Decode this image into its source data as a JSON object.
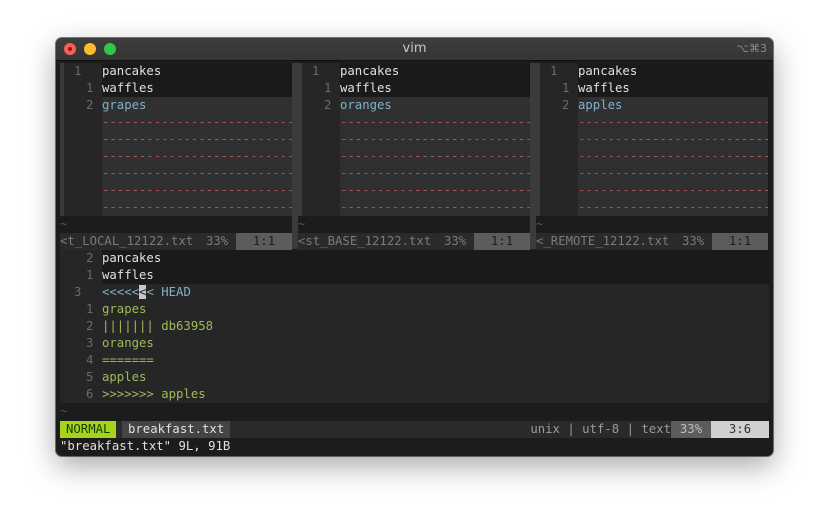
{
  "window": {
    "title": "vim",
    "shortcut": "⌥⌘3"
  },
  "panes": [
    {
      "name": "local",
      "lines": [
        {
          "num": "1",
          "text": "pancakes",
          "style": "dark",
          "numpos": "far"
        },
        {
          "num": "1",
          "text": "waffles",
          "style": "dark",
          "numpos": "near"
        },
        {
          "num": "2",
          "text": "grapes",
          "style": "blue",
          "numpos": "near"
        }
      ],
      "filler_count": 6,
      "filler": "------------------------------------------------------",
      "tilde": "~",
      "status": {
        "filename": "<t_LOCAL_12122.txt",
        "percent": "33%",
        "position": "1:1"
      }
    },
    {
      "name": "base",
      "lines": [
        {
          "num": "1",
          "text": "pancakes",
          "style": "dark",
          "numpos": "far"
        },
        {
          "num": "1",
          "text": "waffles",
          "style": "dark",
          "numpos": "near"
        },
        {
          "num": "2",
          "text": "oranges",
          "style": "blue",
          "numpos": "near"
        }
      ],
      "filler_count": 6,
      "filler": "------------------------------------------------------",
      "tilde": "~",
      "status": {
        "filename": "<st_BASE_12122.txt",
        "percent": "33%",
        "position": "1:1"
      }
    },
    {
      "name": "remote",
      "lines": [
        {
          "num": "1",
          "text": "pancakes",
          "style": "dark",
          "numpos": "far"
        },
        {
          "num": "1",
          "text": "waffles",
          "style": "dark",
          "numpos": "near"
        },
        {
          "num": "2",
          "text": "apples",
          "style": "blue",
          "numpos": "near"
        }
      ],
      "filler_count": 6,
      "filler": "------------------------------------------------------",
      "tilde": "~",
      "status": {
        "filename": "<_REMOTE_12122.txt",
        "percent": "33%",
        "position": "1:1"
      }
    }
  ],
  "merged": {
    "lines": [
      {
        "num": "2",
        "text": "pancakes",
        "style": "dark"
      },
      {
        "num": "1",
        "text": "waffles",
        "style": "dark"
      },
      {
        "num": "3",
        "text_before": "<<<<<",
        "cursor_char": "<",
        "text_after": "< HEAD",
        "style": "head",
        "numpos": "far"
      },
      {
        "num": "1",
        "text": "grapes",
        "style": "green"
      },
      {
        "num": "2",
        "text": "||||||| db63958",
        "style": "green"
      },
      {
        "num": "3",
        "text": "oranges",
        "style": "green"
      },
      {
        "num": "4",
        "text": "=======",
        "style": "green"
      },
      {
        "num": "5",
        "text": "apples",
        "style": "green"
      },
      {
        "num": "6",
        "text": ">>>>>>> apples",
        "style": "green"
      }
    ],
    "tilde": "~"
  },
  "statusline": {
    "mode": "NORMAL",
    "filename": "breakfast.txt",
    "info": "unix | utf-8 | text",
    "percent": "33%",
    "position": "3:6"
  },
  "cmdline": "\"breakfast.txt\" 9L, 91B"
}
